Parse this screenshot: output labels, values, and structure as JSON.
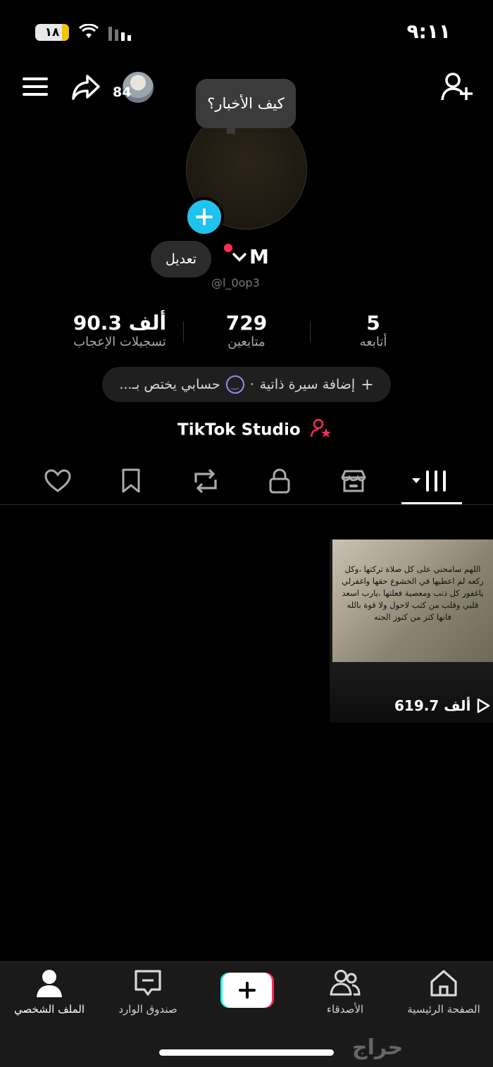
{
  "status_bar": {
    "battery": "١٨",
    "time": "٩:١١"
  },
  "header": {
    "follow_count_badge": "84"
  },
  "profile": {
    "bubble_text": "كيف الأخبار؟",
    "edit_label": "تعديل",
    "name": "M",
    "handle": "@l_0op3"
  },
  "stats": [
    {
      "value": "5",
      "label": "أتابعه"
    },
    {
      "value": "729",
      "label": "متابعين"
    },
    {
      "value": "90.3 ألف",
      "label": "تسجيلات الإعجاب"
    }
  ],
  "bio": {
    "add_bio": "إضافة سيرة ذاتية",
    "separator": "·",
    "account_note": "حسابي يختص بـ..."
  },
  "studio": {
    "label": "TikTok Studio"
  },
  "video": {
    "text": "اللهم سامحني على كل صلاة تركتها ،وكل ركعه لم اعطيها في الخشوع حقها واغفرلي ياغفور كل ذنب ومعصية فعلتها ،يارب اسعد قلبي وقلب من كتب لاحول ولا قوة بالله فانها كنز من كنوز الجنه",
    "views": "619.7 ألف"
  },
  "nav": [
    {
      "label": "الصفحة الرئيسية",
      "icon": "home-icon"
    },
    {
      "label": "الأصدقاء",
      "icon": "friends-icon"
    },
    {
      "label": "",
      "icon": "create-icon"
    },
    {
      "label": "صندوق الوارد",
      "icon": "inbox-icon"
    },
    {
      "label": "الملف الشخصي",
      "icon": "profile-icon"
    }
  ],
  "watermark": "حراج",
  "colors": {
    "accent_red": "#fe2c55",
    "accent_cyan": "#20c2f0",
    "background": "#000000"
  }
}
